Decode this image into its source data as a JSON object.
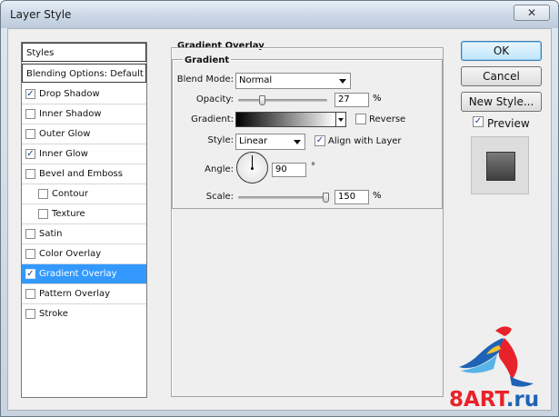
{
  "window": {
    "title": "Layer Style",
    "close_glyph": "✕"
  },
  "styles_list": {
    "header": "Styles",
    "blending": "Blending Options: Default",
    "items": [
      {
        "label": "Drop Shadow",
        "checked": true
      },
      {
        "label": "Inner Shadow",
        "checked": false
      },
      {
        "label": "Outer Glow",
        "checked": false
      },
      {
        "label": "Inner Glow",
        "checked": true
      },
      {
        "label": "Bevel and Emboss",
        "checked": false
      },
      {
        "label": "Contour",
        "checked": false
      },
      {
        "label": "Texture",
        "checked": false
      },
      {
        "label": "Satin",
        "checked": false
      },
      {
        "label": "Color Overlay",
        "checked": false
      },
      {
        "label": "Gradient Overlay",
        "checked": true
      },
      {
        "label": "Pattern Overlay",
        "checked": false
      },
      {
        "label": "Stroke",
        "checked": false
      }
    ],
    "check_glyph": "✓"
  },
  "panel": {
    "section_title": "Gradient Overlay",
    "group_title": "Gradient",
    "blend_mode_label": "Blend Mode:",
    "blend_mode_value": "Normal",
    "opacity_label": "Opacity:",
    "opacity_value": "27",
    "opacity_fraction": 0.27,
    "percent": "%",
    "gradient_label": "Gradient:",
    "reverse_label": "Reverse",
    "reverse_checked": false,
    "style_label": "Style:",
    "style_value": "Linear",
    "align_label": "Align with Layer",
    "align_checked": true,
    "angle_label": "Angle:",
    "angle_value": "90",
    "degree": "°",
    "scale_label": "Scale:",
    "scale_value": "150",
    "scale_fraction": 0.98
  },
  "buttons": {
    "ok": "OK",
    "cancel": "Cancel",
    "new_style": "New Style...",
    "preview_label": "Preview",
    "preview_checked": true
  },
  "watermark": {
    "text_8art": "8ART",
    "text_ru": ".ru"
  },
  "colors": {
    "selected": "#3399ff",
    "brand_red": "#e8222a",
    "brand_blue": "#1e63b5"
  }
}
